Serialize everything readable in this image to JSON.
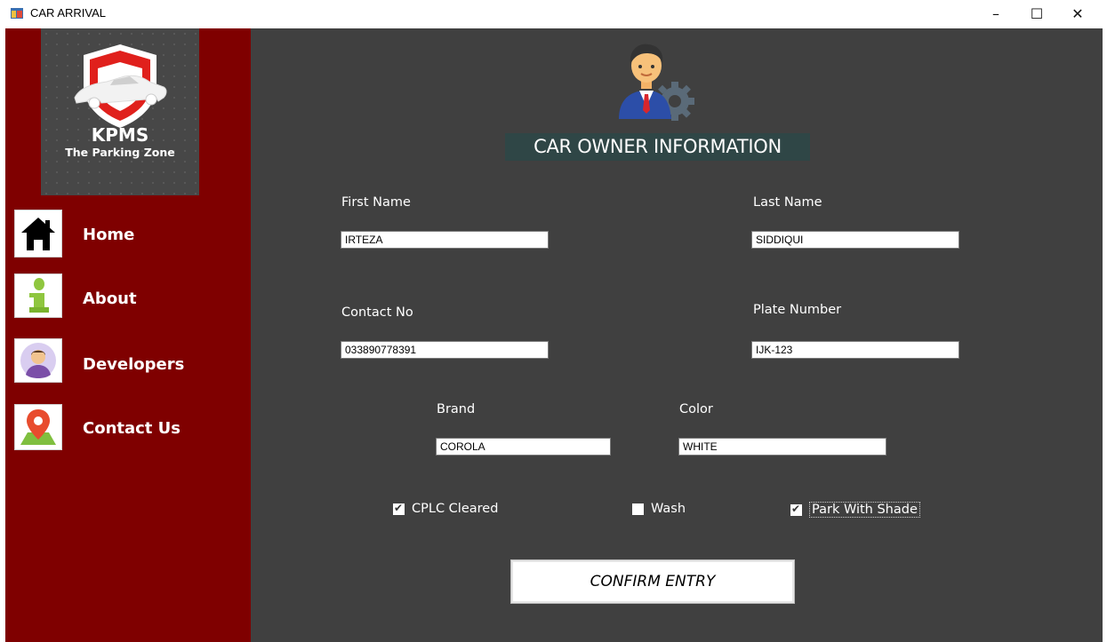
{
  "window": {
    "title": "CAR ARRIVAL",
    "minimize_glyph": "–",
    "maximize_glyph": "☐",
    "close_glyph": "✕"
  },
  "sidebar": {
    "logo_title": "KPMS",
    "logo_subtitle": "The Parking Zone",
    "items": [
      {
        "label": "Home",
        "icon": "house-icon"
      },
      {
        "label": "About",
        "icon": "info-icon"
      },
      {
        "label": "Developers",
        "icon": "developer-avatar-icon"
      },
      {
        "label": "Contact Us",
        "icon": "map-pin-icon"
      }
    ],
    "colors": {
      "background": "#7f0000",
      "logo_panel": "#474747"
    }
  },
  "main": {
    "title": "CAR OWNER INFORMATION",
    "icon": "car-owner-gear-icon",
    "fields": {
      "first_name": {
        "label": "First Name",
        "value": "IRTEZA"
      },
      "last_name": {
        "label": "Last Name",
        "value": "SIDDIQUI"
      },
      "contact_no": {
        "label": "Contact No",
        "value": "033890778391"
      },
      "plate_number": {
        "label": "Plate Number",
        "value": "IJK-123"
      },
      "brand": {
        "label": "Brand",
        "value": "COROLA"
      },
      "color": {
        "label": "Color",
        "value": "WHITE"
      }
    },
    "options": [
      {
        "label": "CPLC Cleared",
        "checked": true
      },
      {
        "label": "Wash",
        "checked": false
      },
      {
        "label": "Park With Shade",
        "checked": true
      }
    ],
    "confirm_label": "CONFIRM ENTRY",
    "colors": {
      "background": "#404040",
      "title_background": "#2f4646"
    }
  }
}
